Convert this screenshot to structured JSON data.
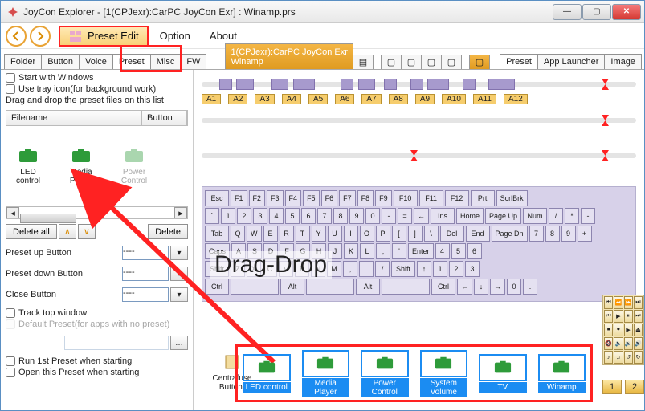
{
  "title": "JoyCon Explorer - [1(CPJexr):CarPC JoyCon Exr] : Winamp.prs",
  "menu": {
    "preset_edit": "Preset Edit",
    "option": "Option",
    "about": "About"
  },
  "left_tabs": [
    "Folder",
    "Button",
    "Voice",
    "Preset",
    "Misc",
    "FW"
  ],
  "active_tab_line1": "1(CPJexr):CarPC JoyCon Exr",
  "active_tab_line2": "Winamp",
  "right_tabs": [
    "Preset",
    "App Launcher",
    "Image"
  ],
  "left": {
    "start_win": "Start with Windows",
    "tray": "Use tray icon(for background work)",
    "dragdrop_hint": "Drag and drop the preset files on this list",
    "col_filename": "Filename",
    "col_button": "Button",
    "items": [
      "LED control",
      "Media Player",
      "Power Control"
    ],
    "delete_all": "Delete all",
    "delete": "Delete",
    "preset_up": "Preset up Button",
    "preset_down": "Preset down Button",
    "close_btn": "Close Button",
    "combo_val": "----",
    "track_top": "Track top window",
    "default_preset": "Default Preset(for apps with no preset)",
    "run_first": "Run 1st Preset when starting",
    "open_this": "Open this Preset when starting"
  },
  "a_labels": [
    "A1",
    "A2",
    "A3",
    "A4",
    "A5",
    "A6",
    "A7",
    "A8",
    "A9",
    "A10",
    "A11",
    "A12"
  ],
  "keyboard": {
    "r1": [
      "Esc",
      "F1",
      "F2",
      "F3",
      "F4",
      "F5",
      "F6",
      "F7",
      "F8",
      "F9",
      "F10",
      "F11",
      "F12",
      "Prt",
      "ScrlBrk"
    ],
    "r2": [
      "`",
      "1",
      "2",
      "3",
      "4",
      "5",
      "6",
      "7",
      "8",
      "9",
      "0",
      "-",
      "=",
      "←",
      "Ins",
      "Home",
      "Page Up",
      "Num",
      "/",
      "*",
      "-"
    ],
    "r3": [
      "Tab",
      "Q",
      "W",
      "E",
      "R",
      "T",
      "Y",
      "U",
      "I",
      "O",
      "P",
      "[",
      "]",
      "\\",
      "Del",
      "End",
      "Page Dn",
      "7",
      "8",
      "9",
      "+"
    ],
    "r4": [
      "Caps",
      "A",
      "S",
      "D",
      "F",
      "G",
      "H",
      "J",
      "K",
      "L",
      ";",
      "'",
      "Enter",
      "4",
      "5",
      "6"
    ],
    "r5": [
      "Shift",
      "Z",
      "X",
      "C",
      "V",
      "B",
      "N",
      "M",
      ",",
      ".",
      "/",
      "Shift",
      "↑",
      "1",
      "2",
      "3"
    ],
    "r6": [
      "Ctrl",
      "",
      "Alt",
      "",
      "Alt",
      "",
      "Ctrl",
      "←",
      "↓",
      "→",
      "0",
      "."
    ]
  },
  "dragdrop_text": "Drag-Drop",
  "centrafuse": "Centrafuse Button)",
  "wp": {
    "one": "1",
    "two": "2"
  },
  "bottom": [
    "LED control",
    "Media Player",
    "Power Control",
    "System Volume",
    "TV",
    "Winamp"
  ]
}
